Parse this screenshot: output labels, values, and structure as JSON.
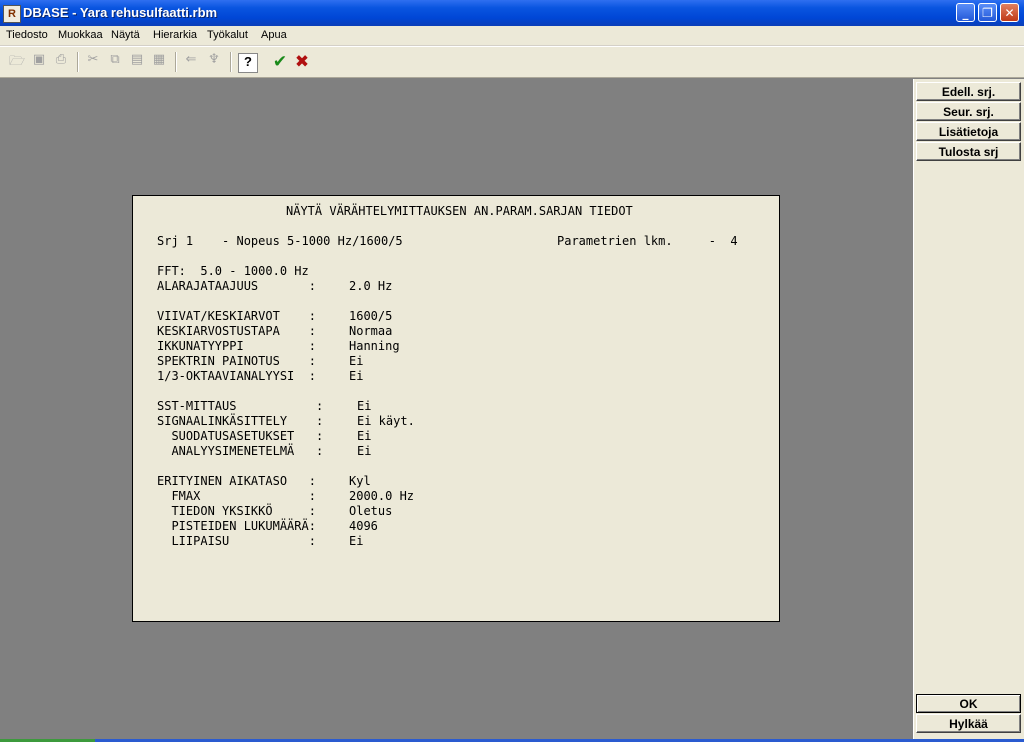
{
  "window": {
    "title": "DBASE - Yara rehusulfaatti.rbm",
    "app_icon": "R"
  },
  "menu": [
    "Tiedosto",
    "Muokkaa",
    "Näytä",
    "Hierarkia",
    "Työkalut",
    "Apua"
  ],
  "toolbar": {
    "icons": [
      "open-folder-icon",
      "save-icon",
      "print-icon",
      "cut-icon",
      "copy-icon",
      "paste-icon",
      "paste-special-icon",
      "back-arrow-icon",
      "tree-icon",
      "help-icon",
      "accept-check-icon",
      "cancel-x-icon"
    ],
    "help_label": "?",
    "ok_glyph": "✔",
    "cancel_glyph": "✖"
  },
  "right_buttons": {
    "prev": "Edell. srj.",
    "next": "Seur. srj.",
    "more": "Lisätietoja",
    "print": "Tulosta srj",
    "ok": "OK",
    "cancel": "Hylkää"
  },
  "panel": {
    "heading": "NÄYTÄ VÄRÄHTELYMITTAUKSEN AN.PARAM.SARJAN TIEDOT",
    "series_line": "Srj 1    - Nopeus 5-1000 Hz/1600/5",
    "param_count_line": "Parametrien lkm.     -  4",
    "fft_line": "FFT:  5.0 - 1000.0 Hz",
    "rows": [
      {
        "label": "ALARAJATAAJUUS       :",
        "value": "2.0 Hz"
      },
      {
        "label": "VIIVAT/KESKIARVOT    :",
        "value": "1600/5"
      },
      {
        "label": "KESKIARVOSTUSTAPA    :",
        "value": "Normaa"
      },
      {
        "label": "IKKUNATYYPPI         :",
        "value": "Hanning"
      },
      {
        "label": "SPEKTRIN PAINOTUS    :",
        "value": "Ei"
      },
      {
        "label": "1/3-OKTAAVIANALYYSI  :",
        "value": "Ei"
      },
      {
        "label": "SST-MITTAUS           :",
        "value": "Ei"
      },
      {
        "label": "SIGNAALINKÄSITTELY    :",
        "value": "Ei käyt."
      },
      {
        "label": "  SUODATUSASETUKSET   :",
        "value": "Ei"
      },
      {
        "label": "  ANALYYSIMENETELMÄ   :",
        "value": "Ei"
      },
      {
        "label": "ERITYINEN AIKATASO   :",
        "value": "Kyl"
      },
      {
        "label": "  FMAX               :",
        "value": "2000.0 Hz"
      },
      {
        "label": "  TIEDON YKSIKKÖ     :",
        "value": "Oletus"
      },
      {
        "label": "  PISTEIDEN LUKUMÄÄRÄ:",
        "value": "4096"
      },
      {
        "label": "  LIIPAISU           :",
        "value": "Ei"
      }
    ]
  }
}
